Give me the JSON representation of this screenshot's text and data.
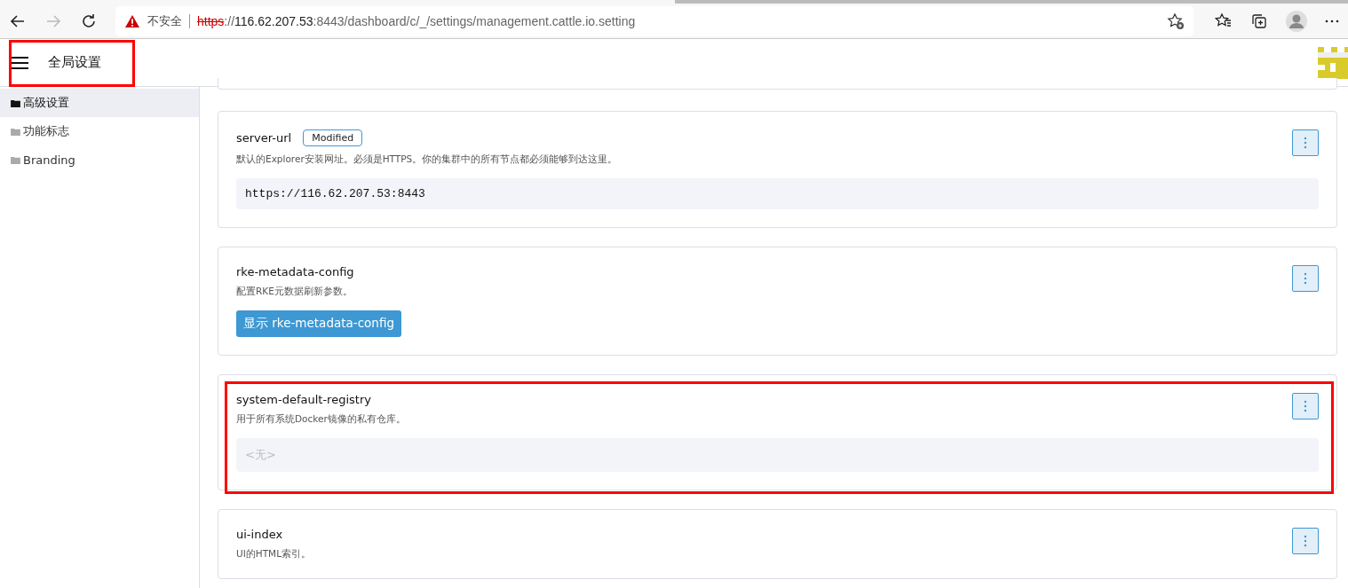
{
  "browser": {
    "security_label": "不安全",
    "url_scheme": "https",
    "url_separator": "://",
    "url_host": "116.62.207.53",
    "url_rest": ":8443/dashboard/c/_/settings/management.cattle.io.setting"
  },
  "header": {
    "title": "全局设置",
    "annotated": true
  },
  "sidebar": {
    "items": [
      {
        "label": "高级设置",
        "selected": true
      },
      {
        "label": "功能标志",
        "selected": false
      },
      {
        "label": "Branding",
        "selected": false
      }
    ]
  },
  "settings": [
    {
      "kind": "value",
      "name": "server-url",
      "badge": "Modified",
      "description": "默认的Explorer安装网址。必须是HTTPS。你的集群中的所有节点都必须能够到达这里。",
      "value": "https://116.62.207.53:8443",
      "annotated": false
    },
    {
      "kind": "button",
      "name": "rke-metadata-config",
      "description": "配置RKE元数据刷新参数。",
      "button_label": "显示 rke-metadata-config",
      "annotated": false
    },
    {
      "kind": "empty",
      "name": "system-default-registry",
      "description": "用于所有系统Docker镜像的私有仓库。",
      "value": "<无>",
      "annotated": true
    },
    {
      "kind": "partial",
      "name": "ui-index",
      "description": "UI的HTML索引。",
      "annotated": false
    }
  ]
}
